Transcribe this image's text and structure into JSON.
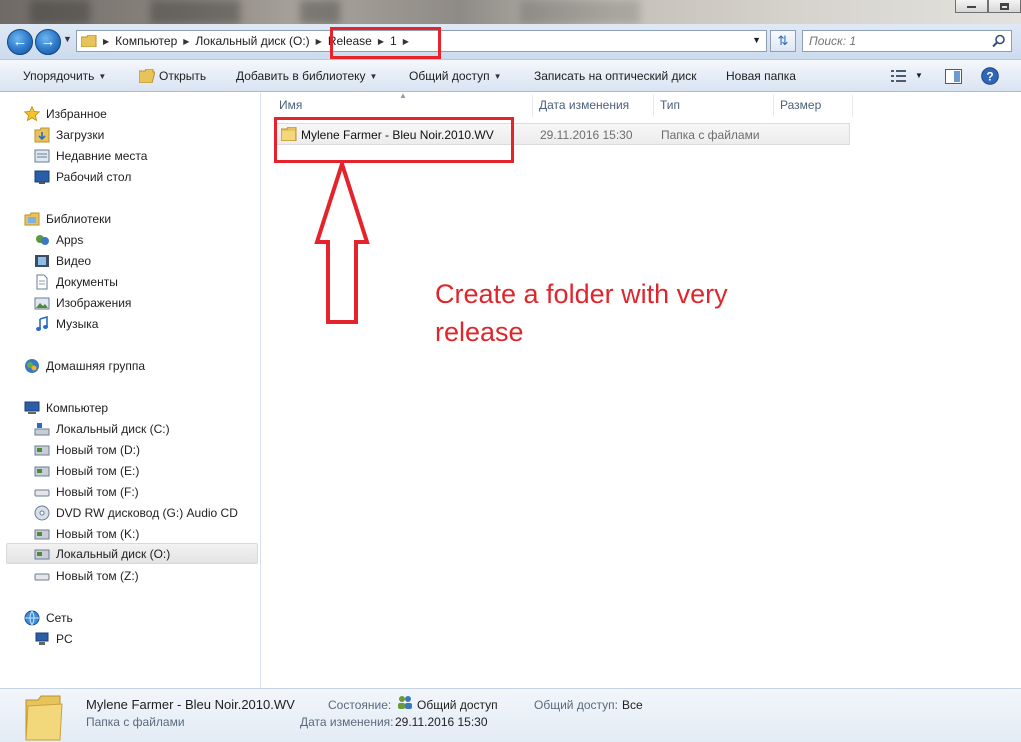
{
  "address": {
    "breadcrumb": [
      "Компьютер",
      "Локальный диск (O:)",
      "Release",
      "1"
    ]
  },
  "search": {
    "placeholder": "Поиск: 1"
  },
  "toolbar": {
    "organize": "Упорядочить",
    "open": "Открыть",
    "add_to_library": "Добавить в библиотеку",
    "share": "Общий доступ",
    "burn": "Записать на оптический диск",
    "new_folder": "Новая папка"
  },
  "sidebar": {
    "favorites": "Избранное",
    "favorites_items": [
      "Загрузки",
      "Недавние места",
      "Рабочий стол"
    ],
    "libraries": "Библиотеки",
    "libraries_items": [
      "Apps",
      "Видео",
      "Документы",
      "Изображения",
      "Музыка"
    ],
    "homegroup": "Домашняя группа",
    "computer": "Компьютер",
    "computer_items": [
      "Локальный диск (C:)",
      "Новый том (D:)",
      "Новый том (E:)",
      "Новый том (F:)",
      "DVD RW дисковод (G:) Audio CD",
      "Новый том (K:)",
      "Локальный диск (O:)",
      "Новый том (Z:)"
    ],
    "network": "Сеть",
    "network_items": [
      "PC"
    ]
  },
  "columns": {
    "name": "Имя",
    "date": "Дата изменения",
    "type": "Тип",
    "size": "Размер"
  },
  "files": [
    {
      "name": "Mylene Farmer - Bleu Noir.2010.WV",
      "date": "29.11.2016 15:30",
      "type": "Папка с файлами"
    }
  ],
  "annotation": {
    "text": "Create a folder with very release",
    "color": "#e0262d"
  },
  "details": {
    "name": "Mylene Farmer - Bleu Noir.2010.WV",
    "kind": "Папка с файлами",
    "state_label": "Состояние:",
    "state_value": "Общий доступ",
    "share_label": "Общий доступ:",
    "share_value": "Все",
    "modified_label": "Дата изменения:",
    "modified_value": "29.11.2016 15:30"
  }
}
